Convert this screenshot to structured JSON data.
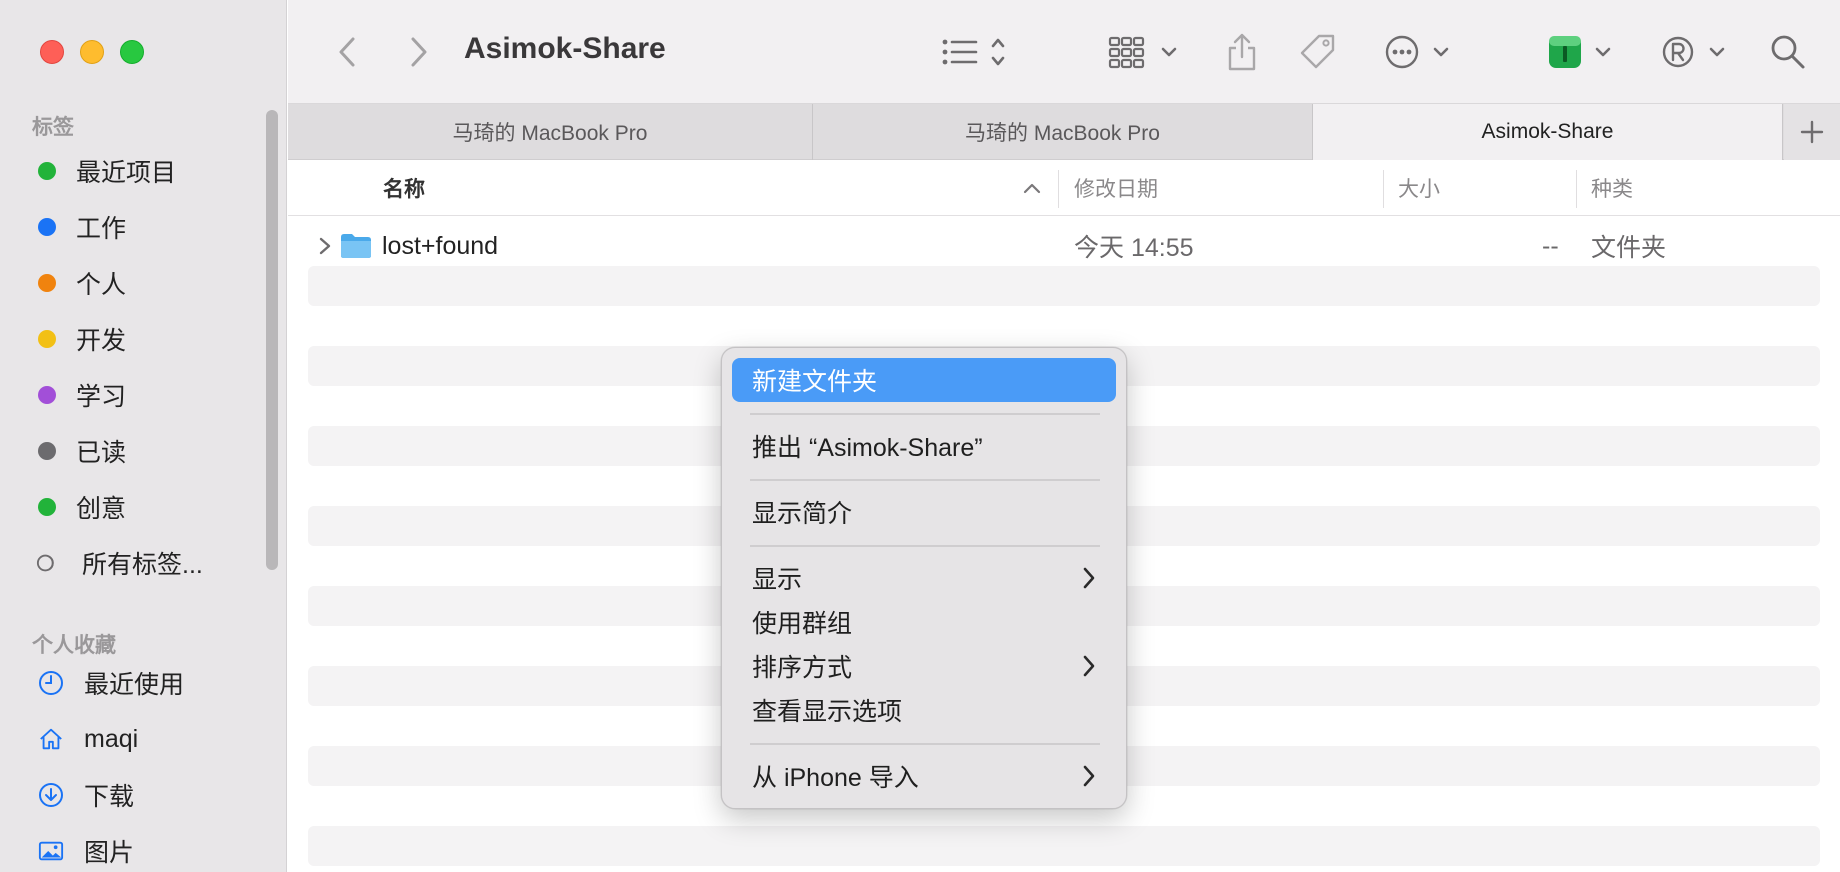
{
  "window": {
    "title": "Asimok-Share"
  },
  "sidebar": {
    "tags_header": "标签",
    "tags": [
      {
        "label": "最近项目",
        "color": "#22b33a"
      },
      {
        "label": "工作",
        "color": "#1a73f5"
      },
      {
        "label": "个人",
        "color": "#f0830e"
      },
      {
        "label": "开发",
        "color": "#f2c015"
      },
      {
        "label": "学习",
        "color": "#a24fd8"
      },
      {
        "label": "已读",
        "color": "#6c6b6e"
      },
      {
        "label": "创意",
        "color": "#22b33a"
      }
    ],
    "all_tags": "所有标签...",
    "favorites_header": "个人收藏",
    "favorites": [
      {
        "label": "最近使用",
        "icon": "clock-icon"
      },
      {
        "label": "maqi",
        "icon": "home-icon"
      },
      {
        "label": "下载",
        "icon": "download-icon"
      },
      {
        "label": "图片",
        "icon": "photo-icon"
      }
    ]
  },
  "tabs": [
    {
      "label": "马琦的 MacBook Pro"
    },
    {
      "label": "马琦的 MacBook Pro"
    },
    {
      "label": "Asimok-Share"
    }
  ],
  "columns": {
    "name": "名称",
    "date": "修改日期",
    "size": "大小",
    "kind": "种类"
  },
  "files": [
    {
      "name": "lost+found",
      "date": "今天 14:55",
      "size": "--",
      "kind": "文件夹"
    }
  ],
  "context_menu": {
    "items": [
      {
        "label": "新建文件夹",
        "highlighted": true
      },
      {
        "label": "推出 “Asimok-Share”"
      },
      {
        "label": "显示简介"
      },
      {
        "label": "显示",
        "submenu": true
      },
      {
        "label": "使用群组"
      },
      {
        "label": "排序方式",
        "submenu": true
      },
      {
        "label": "查看显示选项"
      },
      {
        "label": "从 iPhone 导入",
        "submenu": true
      }
    ]
  }
}
